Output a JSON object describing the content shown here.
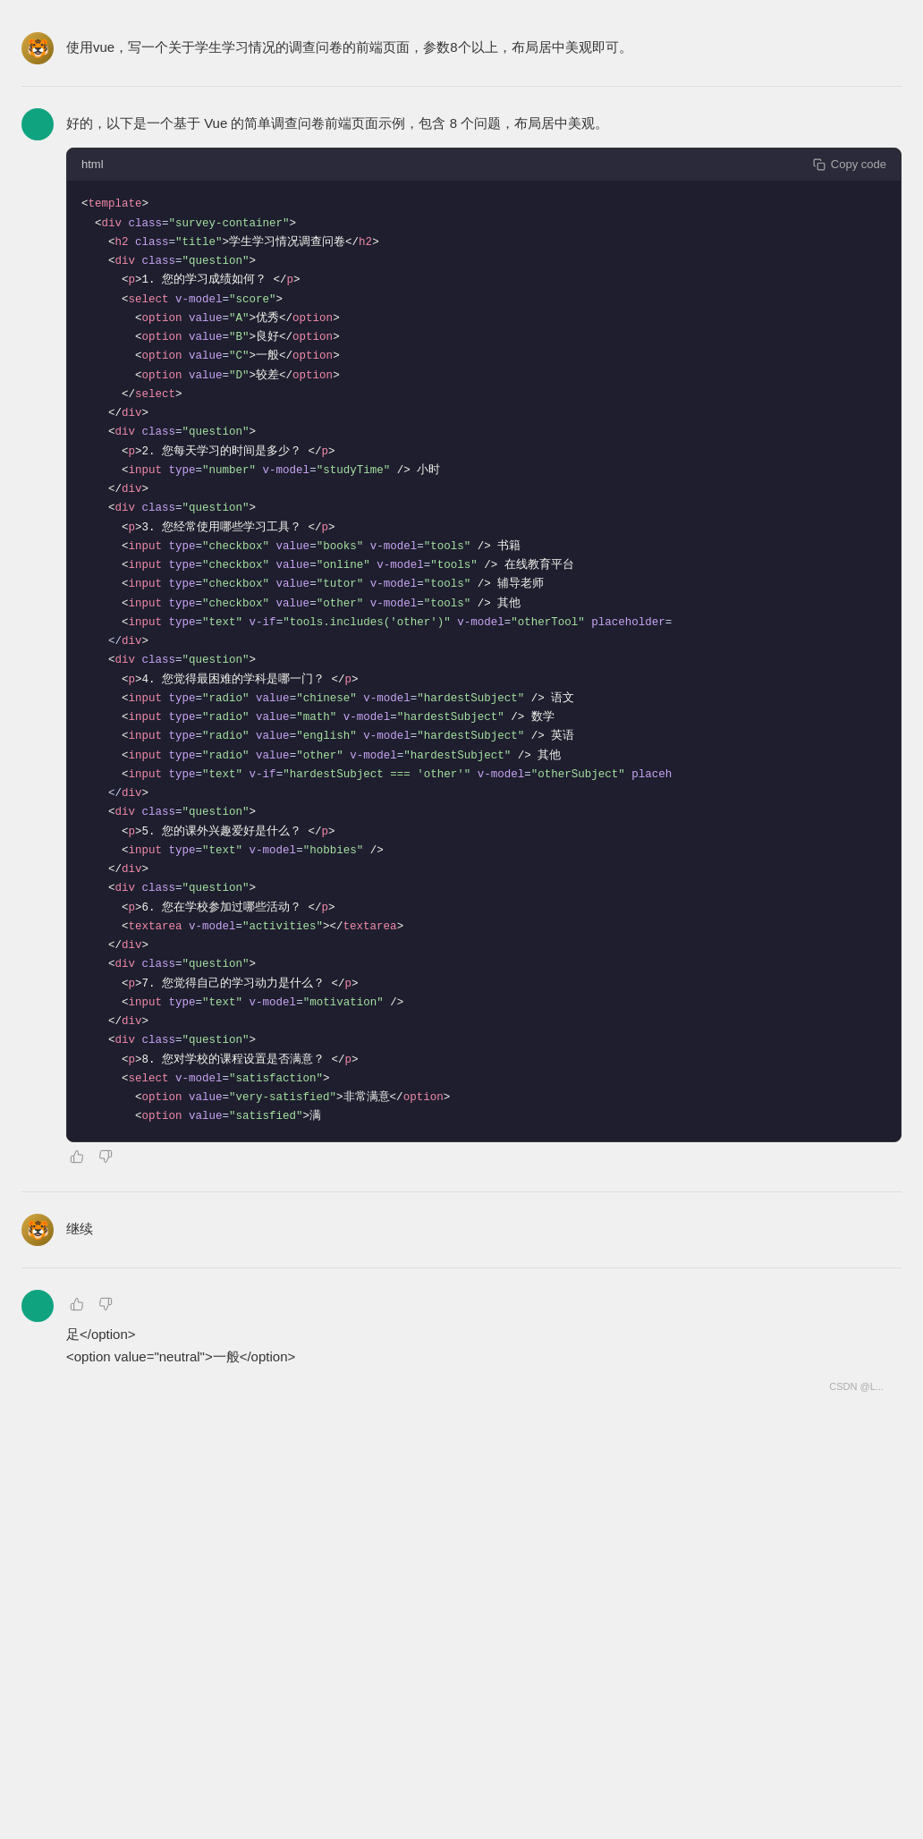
{
  "messages": [
    {
      "id": "user-1",
      "role": "user",
      "avatar_type": "user",
      "text": "使用vue，写一个关于学生学习情况的调查问卷的前端页面，参数8个以上，布局居中美观即可。"
    },
    {
      "id": "assistant-1",
      "role": "assistant",
      "avatar_type": "gpt",
      "text": "好的，以下是一个基于 Vue 的简单调查问卷前端页面示例，包含 8 个问题，布局居中美观。",
      "has_actions": true,
      "code_block": {
        "lang": "html",
        "copy_label": "Copy code",
        "lines": [
          {
            "type": "plain",
            "content": "<template>"
          },
          {
            "type": "plain",
            "content": "  <div ",
            "parts": [
              {
                "type": "plain",
                "t": "  "
              },
              {
                "type": "attr-name",
                "t": "class"
              },
              {
                "type": "plain",
                "t": "="
              },
              {
                "type": "attr-value",
                "t": "\"survey-container\""
              },
              {
                "type": "plain",
                "t": ">"
              }
            ]
          },
          {
            "type": "plain",
            "content": "    <h2 class=\"title\">学生学习情况调查问卷</h2>"
          },
          {
            "type": "plain",
            "content": "    <div class=\"question\">"
          },
          {
            "type": "plain",
            "content": "      <p>1. 您的学习成绩如何？</p>"
          },
          {
            "type": "plain",
            "content": "      <select v-model=\"score\">"
          },
          {
            "type": "plain",
            "content": "        <option value=\"A\">优秀</option>"
          },
          {
            "type": "plain",
            "content": "        <option value=\"B\">良好</option>"
          },
          {
            "type": "plain",
            "content": "        <option value=\"C\">一般</option>"
          },
          {
            "type": "plain",
            "content": "        <option value=\"D\">较差</option>"
          },
          {
            "type": "plain",
            "content": "      </select>"
          },
          {
            "type": "plain",
            "content": "    </div>"
          },
          {
            "type": "plain",
            "content": "    <div class=\"question\">"
          },
          {
            "type": "plain",
            "content": "      <p>2. 您每天学习的时间是多少？</p>"
          },
          {
            "type": "plain",
            "content": "      <input type=\"number\" v-model=\"studyTime\" /> 小时"
          },
          {
            "type": "plain",
            "content": "    </div>"
          },
          {
            "type": "plain",
            "content": "    <div class=\"question\">"
          },
          {
            "type": "plain",
            "content": "      <p>3. 您经常使用哪些学习工具？</p>"
          },
          {
            "type": "plain",
            "content": "      <input type=\"checkbox\" value=\"books\" v-model=\"tools\" /> 书籍"
          },
          {
            "type": "plain",
            "content": "      <input type=\"checkbox\" value=\"online\" v-model=\"tools\" /> 在线教育平台"
          },
          {
            "type": "plain",
            "content": "      <input type=\"checkbox\" value=\"tutor\" v-model=\"tools\" /> 辅导老师"
          },
          {
            "type": "plain",
            "content": "      <input type=\"checkbox\" value=\"other\" v-model=\"tools\" /> 其他"
          },
          {
            "type": "plain",
            "content": "      <input type=\"text\" v-if=\"tools.includes('other')\" v-model=\"otherTool\" placeholder="
          },
          {
            "type": "plain",
            "content": "    </div>"
          },
          {
            "type": "plain",
            "content": "    <div class=\"question\">"
          },
          {
            "type": "plain",
            "content": "      <p>4. 您觉得最困难的学科是哪一门？</p>"
          },
          {
            "type": "plain",
            "content": "      <input type=\"radio\" value=\"chinese\" v-model=\"hardestSubject\" /> 语文"
          },
          {
            "type": "plain",
            "content": "      <input type=\"radio\" value=\"math\" v-model=\"hardestSubject\" /> 数学"
          },
          {
            "type": "plain",
            "content": "      <input type=\"radio\" value=\"english\" v-model=\"hardestSubject\" /> 英语"
          },
          {
            "type": "plain",
            "content": "      <input type=\"radio\" value=\"other\" v-model=\"hardestSubject\" /> 其他"
          },
          {
            "type": "plain",
            "content": "      <input type=\"text\" v-if=\"hardestSubject === 'other'\" v-model=\"otherSubject\" placeh"
          },
          {
            "type": "plain",
            "content": "    </div>"
          },
          {
            "type": "plain",
            "content": "    <div class=\"question\">"
          },
          {
            "type": "plain",
            "content": "      <p>5. 您的课外兴趣爱好是什么？</p>"
          },
          {
            "type": "plain",
            "content": "      <input type=\"text\" v-model=\"hobbies\" />"
          },
          {
            "type": "plain",
            "content": "    </div>"
          },
          {
            "type": "plain",
            "content": "    <div class=\"question\">"
          },
          {
            "type": "plain",
            "content": "      <p>6. 您在学校参加过哪些活动？</p>"
          },
          {
            "type": "plain",
            "content": "      <textarea v-model=\"activities\"></textarea>"
          },
          {
            "type": "plain",
            "content": "    </div>"
          },
          {
            "type": "plain",
            "content": "    <div class=\"question\">"
          },
          {
            "type": "plain",
            "content": "      <p>7. 您觉得自己的学习动力是什么？</p>"
          },
          {
            "type": "plain",
            "content": "      <input type=\"text\" v-model=\"motivation\" />"
          },
          {
            "type": "plain",
            "content": "    </div>"
          },
          {
            "type": "plain",
            "content": "    <div class=\"question\">"
          },
          {
            "type": "plain",
            "content": "      <p>8. 您对学校的课程设置是否满意？</p>"
          },
          {
            "type": "plain",
            "content": "      <select v-model=\"satisfaction\">"
          },
          {
            "type": "plain",
            "content": "        <option value=\"very-satisfied\">非常满意</option>"
          },
          {
            "type": "plain",
            "content": "        <option value=\"satisfied\">满"
          }
        ]
      }
    },
    {
      "id": "user-2",
      "role": "user",
      "avatar_type": "user",
      "text": "继续"
    },
    {
      "id": "assistant-2",
      "role": "assistant",
      "avatar_type": "gpt",
      "has_actions": true,
      "continuation_lines": [
        "足</option>",
        "<option value=\"neutral\">一般</option>"
      ],
      "watermark": "CSDN @L..."
    }
  ],
  "ui": {
    "copy_code": "Copy code",
    "lang_html": "html"
  }
}
